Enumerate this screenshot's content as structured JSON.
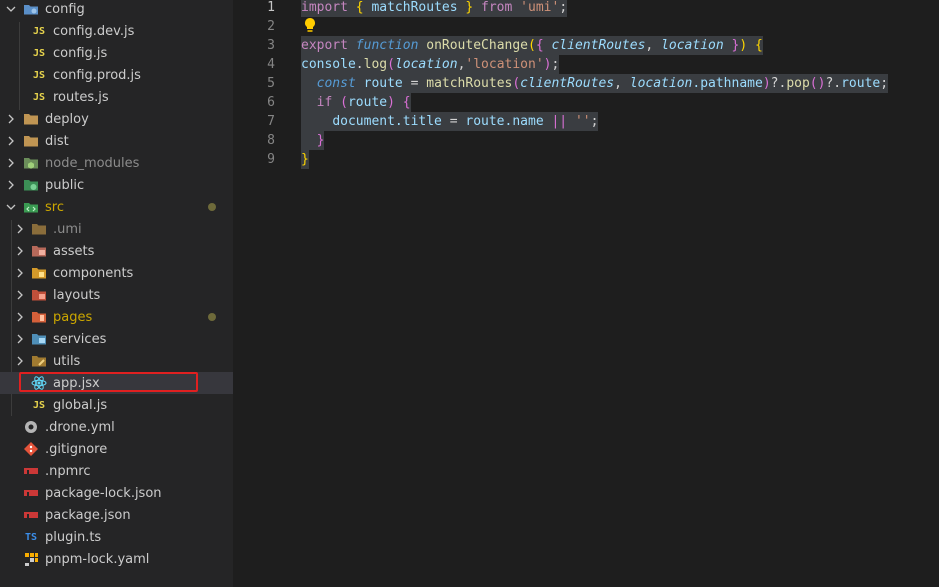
{
  "sidebar": {
    "rows": [
      {
        "label": "config",
        "icon": "folder-config-icon",
        "expanded": true
      },
      {
        "label": "config.dev.js",
        "icon": "js-file-icon"
      },
      {
        "label": "config.js",
        "icon": "js-file-icon"
      },
      {
        "label": "config.prod.js",
        "icon": "js-file-icon"
      },
      {
        "label": "routes.js",
        "icon": "js-file-icon"
      },
      {
        "label": "deploy",
        "icon": "folder-icon"
      },
      {
        "label": "dist",
        "icon": "folder-icon"
      },
      {
        "label": "node_modules",
        "icon": "folder-node-icon"
      },
      {
        "label": "public",
        "icon": "folder-public-icon"
      },
      {
        "label": "src",
        "icon": "folder-src-icon",
        "expanded": true
      },
      {
        "label": ".umi",
        "icon": "folder-icon"
      },
      {
        "label": "assets",
        "icon": "folder-assets-icon"
      },
      {
        "label": "components",
        "icon": "folder-components-icon"
      },
      {
        "label": "layouts",
        "icon": "folder-layouts-icon"
      },
      {
        "label": "pages",
        "icon": "folder-pages-icon"
      },
      {
        "label": "services",
        "icon": "folder-services-icon"
      },
      {
        "label": "utils",
        "icon": "folder-utils-icon"
      },
      {
        "label": "app.jsx",
        "icon": "react-icon",
        "selected": true
      },
      {
        "label": "global.js",
        "icon": "js-file-icon"
      },
      {
        "label": ".drone.yml",
        "icon": "drone-icon"
      },
      {
        "label": ".gitignore",
        "icon": "git-icon"
      },
      {
        "label": ".npmrc",
        "icon": "npm-icon"
      },
      {
        "label": "package-lock.json",
        "icon": "npm-icon"
      },
      {
        "label": "package.json",
        "icon": "npm-icon"
      },
      {
        "label": "plugin.ts",
        "icon": "ts-file-icon"
      },
      {
        "label": "pnpm-lock.yaml",
        "icon": "pnpm-icon"
      }
    ],
    "js_badge": "JS",
    "ts_badge": "TS"
  },
  "editor": {
    "line_numbers": [
      "1",
      "2",
      "3",
      "4",
      "5",
      "6",
      "7",
      "8",
      "9"
    ],
    "active_line": "1",
    "code": {
      "l1": {
        "import": "import",
        "b1": "{",
        "name": "matchRoutes",
        "b2": "}",
        "from": "from",
        "mod": "'umi'",
        "semi": ";"
      },
      "l3": {
        "export": "export",
        "function": "function",
        "fn": "onRouteChange",
        "p1": "(",
        "b1": "{",
        "a": "clientRoutes",
        "comma": ",",
        "b": "location",
        "b2": "}",
        "p2": ")",
        "b3": "{"
      },
      "l4": {
        "console": "console",
        "dot": ".",
        "log": "log",
        "p1": "(",
        "arg": "location",
        "comma": ",",
        "str": "'location'",
        "p2": ")",
        "semi": ";"
      },
      "l5": {
        "const": "const",
        "route": "route",
        "eq": "=",
        "fn": "matchRoutes",
        "p1": "(",
        "a": "clientRoutes",
        "comma": ",",
        "b": "location",
        "pp": ".pathname",
        "p2": ")",
        "q1": "?.",
        "pop": "pop",
        "p3": "()",
        "q2": "?.",
        "route2": "route",
        "semi": ";"
      },
      "l6": {
        "if": "if",
        "p1": "(",
        "route": "route",
        "p2": ")",
        "b": "{"
      },
      "l7": {
        "doc": "document.title",
        "eq": "=",
        "route": "route.name",
        "or": "||",
        "str": "''",
        "semi": ";"
      },
      "l8": {
        "b": "}"
      },
      "l9": {
        "b": "}"
      }
    }
  },
  "colors": {
    "selection_outline": "#e02020",
    "modified": "#cca700",
    "folder": "#c09553"
  }
}
